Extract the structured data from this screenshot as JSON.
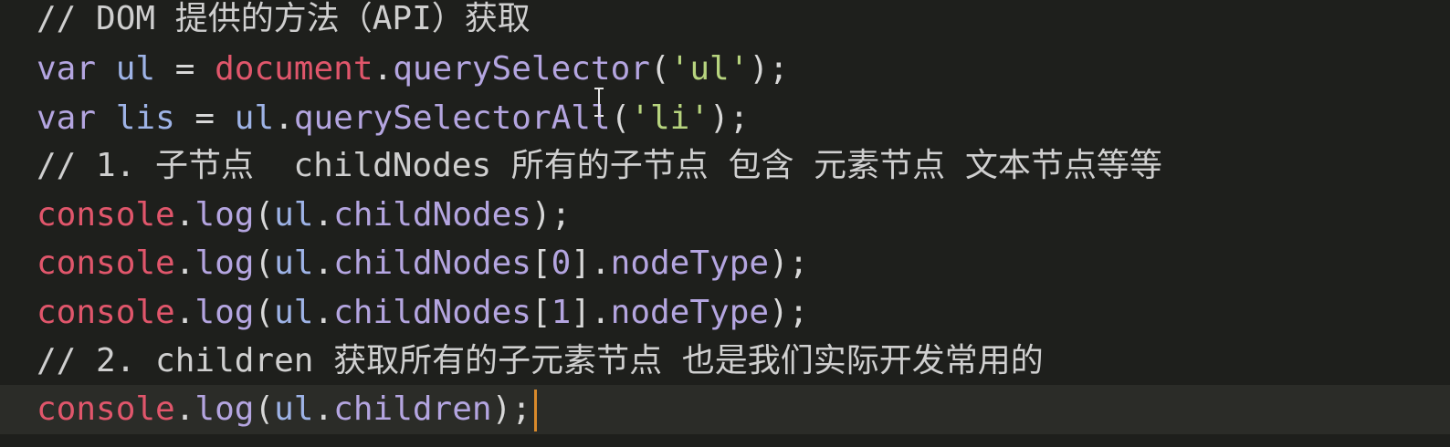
{
  "editor": {
    "lines": [
      [
        {
          "t": "// DOM 提供的方法（API）获取",
          "c": "comment"
        }
      ],
      [
        {
          "t": "var",
          "c": "keyword"
        },
        {
          "t": " ",
          "c": "punct"
        },
        {
          "t": "ul",
          "c": "var"
        },
        {
          "t": " = ",
          "c": "punct"
        },
        {
          "t": "document",
          "c": "builtin"
        },
        {
          "t": ".",
          "c": "punct"
        },
        {
          "t": "querySelector",
          "c": "method"
        },
        {
          "t": "(",
          "c": "punct"
        },
        {
          "t": "'ul'",
          "c": "string"
        },
        {
          "t": ");",
          "c": "punct"
        }
      ],
      [
        {
          "t": "var",
          "c": "keyword"
        },
        {
          "t": " ",
          "c": "punct"
        },
        {
          "t": "lis",
          "c": "var"
        },
        {
          "t": " = ",
          "c": "punct"
        },
        {
          "t": "ul",
          "c": "var"
        },
        {
          "t": ".",
          "c": "punct"
        },
        {
          "t": "querySelectorAll",
          "c": "method"
        },
        {
          "t": "(",
          "c": "punct"
        },
        {
          "t": "'li'",
          "c": "string"
        },
        {
          "t": ");",
          "c": "punct"
        }
      ],
      [
        {
          "t": "// 1. 子节点  childNodes 所有的子节点 包含 元素节点 文本节点等等",
          "c": "comment"
        }
      ],
      [
        {
          "t": "console",
          "c": "builtin"
        },
        {
          "t": ".",
          "c": "punct"
        },
        {
          "t": "log",
          "c": "method"
        },
        {
          "t": "(",
          "c": "punct"
        },
        {
          "t": "ul",
          "c": "var"
        },
        {
          "t": ".",
          "c": "punct"
        },
        {
          "t": "childNodes",
          "c": "method"
        },
        {
          "t": ");",
          "c": "punct"
        }
      ],
      [
        {
          "t": "console",
          "c": "builtin"
        },
        {
          "t": ".",
          "c": "punct"
        },
        {
          "t": "log",
          "c": "method"
        },
        {
          "t": "(",
          "c": "punct"
        },
        {
          "t": "ul",
          "c": "var"
        },
        {
          "t": ".",
          "c": "punct"
        },
        {
          "t": "childNodes",
          "c": "method"
        },
        {
          "t": "[",
          "c": "punct"
        },
        {
          "t": "0",
          "c": "number"
        },
        {
          "t": "].",
          "c": "punct"
        },
        {
          "t": "nodeType",
          "c": "method"
        },
        {
          "t": ");",
          "c": "punct"
        }
      ],
      [
        {
          "t": "console",
          "c": "builtin"
        },
        {
          "t": ".",
          "c": "punct"
        },
        {
          "t": "log",
          "c": "method"
        },
        {
          "t": "(",
          "c": "punct"
        },
        {
          "t": "ul",
          "c": "var"
        },
        {
          "t": ".",
          "c": "punct"
        },
        {
          "t": "childNodes",
          "c": "method"
        },
        {
          "t": "[",
          "c": "punct"
        },
        {
          "t": "1",
          "c": "number"
        },
        {
          "t": "].",
          "c": "punct"
        },
        {
          "t": "nodeType",
          "c": "method"
        },
        {
          "t": ");",
          "c": "punct"
        }
      ],
      [
        {
          "t": "// 2. children 获取所有的子元素节点 也是我们实际开发常用的",
          "c": "comment"
        }
      ],
      [
        {
          "t": "console",
          "c": "builtin"
        },
        {
          "t": ".",
          "c": "punct"
        },
        {
          "t": "log",
          "c": "method"
        },
        {
          "t": "(",
          "c": "punct"
        },
        {
          "t": "ul",
          "c": "var"
        },
        {
          "t": ".",
          "c": "punct"
        },
        {
          "t": "children",
          "c": "method"
        },
        {
          "t": ");",
          "c": "punct"
        }
      ]
    ],
    "current_line": 8,
    "colors": {
      "background": "#1e1f1c",
      "current_line": "#2b2c28",
      "comment": "#cfcfcf",
      "keyword": "#b4a5e0",
      "builtin": "#e0566b",
      "string": "#b7d47e",
      "caret": "#d98a2b"
    }
  }
}
